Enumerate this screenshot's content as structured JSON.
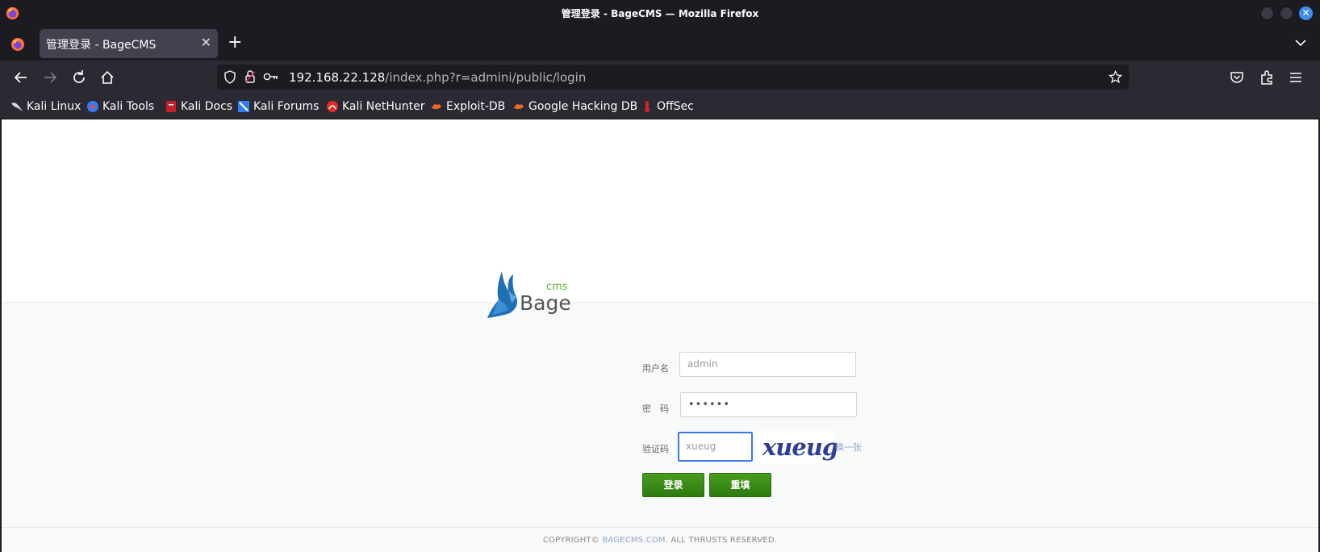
{
  "window": {
    "title": "管理登录 - BageCMS — Mozilla Firefox",
    "close_glyph": "✕"
  },
  "tabs": [
    {
      "label": "管理登录 - BageCMS",
      "active": true,
      "close_glyph": "✕"
    }
  ],
  "tabstrip": {
    "new_tab_glyph": "+"
  },
  "navbar": {
    "url_host": "192.168.22.128",
    "url_path": "/index.php?r=admini/public/login"
  },
  "bookmarks": [
    {
      "label": "Kali Linux",
      "icon": "kali-dragon-icon"
    },
    {
      "label": "Kali Tools",
      "icon": "kali-tools-icon"
    },
    {
      "label": "Kali Docs",
      "icon": "kali-docs-icon"
    },
    {
      "label": "Kali Forums",
      "icon": "kali-forums-icon"
    },
    {
      "label": "Kali NetHunter",
      "icon": "kali-nethunter-icon"
    },
    {
      "label": "Exploit-DB",
      "icon": "exploit-db-icon"
    },
    {
      "label": "Google Hacking DB",
      "icon": "ghdb-icon"
    },
    {
      "label": "OffSec",
      "icon": "offsec-icon"
    }
  ],
  "login": {
    "logo_word": "Bage",
    "logo_sub": "cms",
    "username_label": "用户名",
    "username_value": "admin",
    "password_label": "密　码",
    "password_value": "••••••",
    "captcha_label": "验证码",
    "captcha_value": "xueug",
    "captcha_image_text": "xueug",
    "refresh_label": "换一张",
    "submit_label": "登录",
    "reset_label": "重填"
  },
  "footer": {
    "prefix": "COPYRIGHT© ",
    "site": "BAGECMS.COM",
    "suffix": ". ALL THRUSTS RESERVED."
  },
  "colors": {
    "browser_bg": "#1c1b22",
    "toolbar_bg": "#2b2a33",
    "button_green": "#3a8a16",
    "link_blue": "#8fa5c7",
    "focus_blue": "#3b78e7"
  }
}
